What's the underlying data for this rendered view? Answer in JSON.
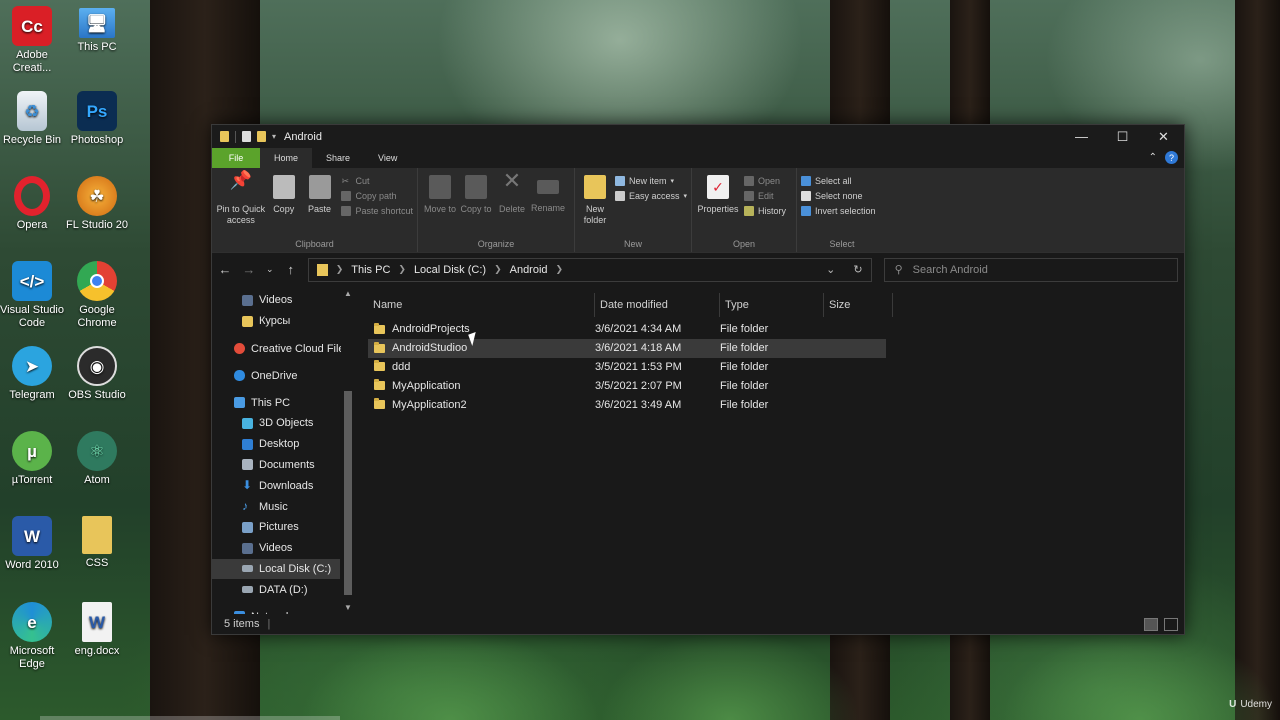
{
  "desktop": {
    "icons": [
      {
        "label": "Adobe Creati...",
        "icon": "adobe-cc-icon",
        "color": "#da1f26"
      },
      {
        "label": "This PC",
        "icon": "computer-icon",
        "color": "#3b8fd9"
      },
      {
        "label": "Recycle Bin",
        "icon": "recycle-bin-icon",
        "color": "#d8e4ee"
      },
      {
        "label": "Photoshop",
        "icon": "photoshop-icon",
        "color": "#0b2d52"
      },
      {
        "label": "Opera",
        "icon": "opera-icon",
        "color": "#e2222d"
      },
      {
        "label": "FL Studio 20",
        "icon": "fl-studio-icon",
        "color": "#f08a1c"
      },
      {
        "label": "Visual Studio Code",
        "icon": "vscode-icon",
        "color": "#1c8ad6"
      },
      {
        "label": "Google Chrome",
        "icon": "chrome-icon",
        "color": "#e34133"
      },
      {
        "label": "Telegram",
        "icon": "telegram-icon",
        "color": "#2ba4df"
      },
      {
        "label": "OBS Studio",
        "icon": "obs-icon",
        "color": "#2b2b2b"
      },
      {
        "label": "µTorrent",
        "icon": "utorrent-icon",
        "color": "#5bb34a"
      },
      {
        "label": "Atom",
        "icon": "atom-icon",
        "color": "#66c89a"
      },
      {
        "label": "Word 2010",
        "icon": "word-icon",
        "color": "#2a5aa8"
      },
      {
        "label": "CSS",
        "icon": "folder-icon",
        "color": "#e8c55a"
      },
      {
        "label": "Microsoft Edge",
        "icon": "edge-icon",
        "color": "#1f8fd6"
      },
      {
        "label": "eng.docx",
        "icon": "docx-icon",
        "color": "#2a5aa8"
      }
    ]
  },
  "window": {
    "title": "Android",
    "controls": {
      "minimize": "—",
      "maximize": "☐",
      "close": "✕"
    }
  },
  "tabs": {
    "file": "File",
    "home": "Home",
    "share": "Share",
    "view": "View"
  },
  "ribbon": {
    "clipboard": {
      "label": "Clipboard",
      "pin": "Pin to Quick access",
      "copy": "Copy",
      "paste": "Paste",
      "cut": "Cut",
      "copy_path": "Copy path",
      "paste_shortcut": "Paste shortcut"
    },
    "organize": {
      "label": "Organize",
      "move_to": "Move to",
      "copy_to": "Copy to",
      "delete": "Delete",
      "rename": "Rename"
    },
    "new": {
      "label": "New",
      "new_folder": "New folder",
      "new_item": "New item",
      "easy_access": "Easy access"
    },
    "open": {
      "label": "Open",
      "properties": "Properties",
      "open": "Open",
      "edit": "Edit",
      "history": "History"
    },
    "select": {
      "label": "Select",
      "select_all": "Select all",
      "select_none": "Select none",
      "invert": "Invert selection"
    }
  },
  "address": {
    "crumbs": [
      "This PC",
      "Local Disk (C:)",
      "Android"
    ],
    "search_placeholder": "Search Android"
  },
  "navpane": {
    "items": [
      {
        "label": "Videos",
        "icon": "videos-icon",
        "indent": 1
      },
      {
        "label": "Курсы",
        "icon": "folder-icon",
        "indent": 1
      },
      {
        "label": "Creative Cloud Files",
        "icon": "creative-cloud-icon",
        "indent": 0
      },
      {
        "label": "OneDrive",
        "icon": "onedrive-icon",
        "indent": 0
      },
      {
        "label": "This PC",
        "icon": "computer-icon",
        "indent": 0
      },
      {
        "label": "3D Objects",
        "icon": "3d-objects-icon",
        "indent": 1
      },
      {
        "label": "Desktop",
        "icon": "desktop-icon",
        "indent": 1
      },
      {
        "label": "Documents",
        "icon": "documents-icon",
        "indent": 1
      },
      {
        "label": "Downloads",
        "icon": "downloads-icon",
        "indent": 1
      },
      {
        "label": "Music",
        "icon": "music-icon",
        "indent": 1
      },
      {
        "label": "Pictures",
        "icon": "pictures-icon",
        "indent": 1
      },
      {
        "label": "Videos",
        "icon": "videos-icon",
        "indent": 1
      },
      {
        "label": "Local Disk (C:)",
        "icon": "drive-icon",
        "indent": 1,
        "selected": true
      },
      {
        "label": "DATA (D:)",
        "icon": "drive-icon",
        "indent": 1
      },
      {
        "label": "Network",
        "icon": "network-icon",
        "indent": 0
      }
    ]
  },
  "columns": {
    "name": "Name",
    "date": "Date modified",
    "type": "Type",
    "size": "Size"
  },
  "files": [
    {
      "name": "AndroidProjects",
      "date": "3/6/2021 4:34 AM",
      "type": "File folder"
    },
    {
      "name": "AndroidStudioo",
      "date": "3/6/2021 4:18 AM",
      "type": "File folder",
      "hover": true
    },
    {
      "name": "ddd",
      "date": "3/5/2021 1:53 PM",
      "type": "File folder"
    },
    {
      "name": "MyApplication",
      "date": "3/5/2021 2:07 PM",
      "type": "File folder"
    },
    {
      "name": "MyApplication2",
      "date": "3/6/2021 3:49 AM",
      "type": "File folder"
    }
  ],
  "status": {
    "items": "5 items"
  },
  "watermark": "Udemy",
  "colors": {
    "file_tab": "#5ba32b",
    "folder": "#e8c55a",
    "window_bg": "#191919",
    "ribbon_bg": "#2b2b2b"
  }
}
